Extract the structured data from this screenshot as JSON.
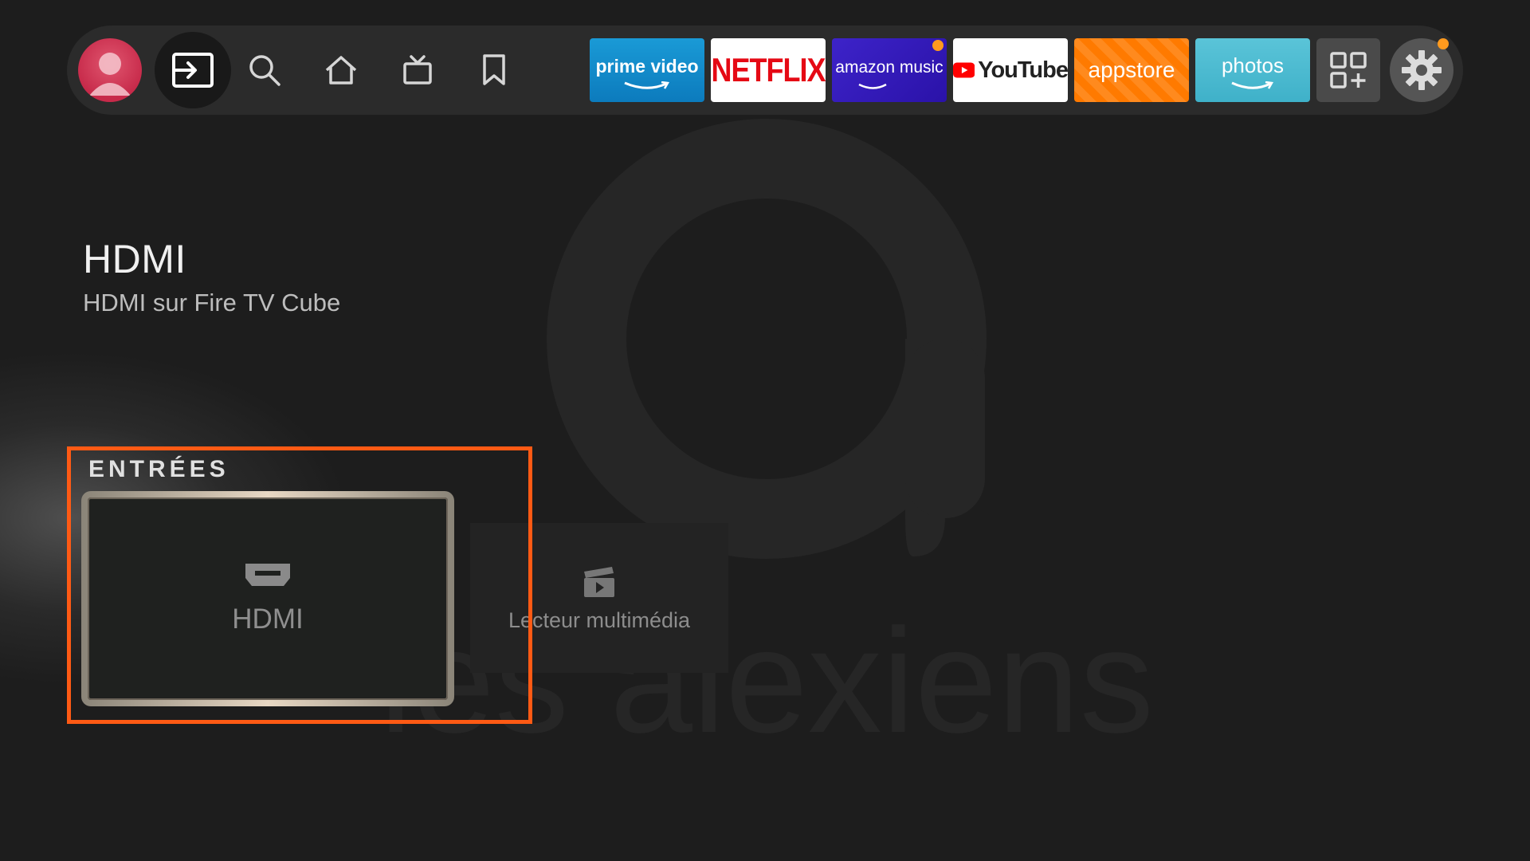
{
  "nav": {
    "items": [
      {
        "name": "profile",
        "icon": "user-avatar-icon"
      },
      {
        "name": "inputs",
        "icon": "input-icon"
      },
      {
        "name": "search",
        "icon": "search-icon"
      },
      {
        "name": "home",
        "icon": "home-icon"
      },
      {
        "name": "live",
        "icon": "tv-icon"
      },
      {
        "name": "watchlist",
        "icon": "bookmark-icon"
      }
    ],
    "apps": {
      "prime_video": "prime video",
      "netflix": "NETFLIX",
      "amazon_music": "amazon music",
      "youtube": "YouTube",
      "appstore": "appstore",
      "photos": "photos"
    }
  },
  "content": {
    "title": "HDMI",
    "subtitle": "HDMI sur Fire TV Cube"
  },
  "inputs_section": {
    "label": "ENTRÉES",
    "tiles": [
      {
        "label": "HDMI",
        "icon": "hdmi-port-icon",
        "focused": true
      },
      {
        "label": "Lecteur multimédia",
        "icon": "media-player-icon",
        "focused": false
      }
    ]
  },
  "watermark": {
    "text": "les alexiens"
  },
  "colors": {
    "background": "#1d1d1d",
    "navbar": "#2b2b2b",
    "highlight": "#ff5a14",
    "notification": "#ff9a1e"
  }
}
